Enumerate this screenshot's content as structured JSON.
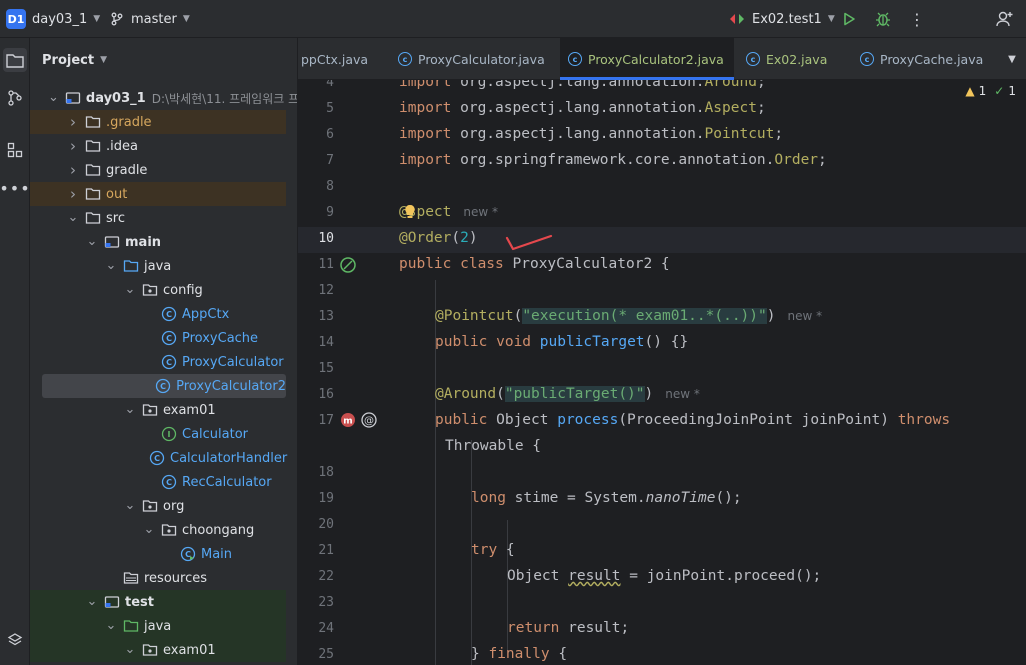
{
  "titlebar": {
    "project_badge": "D1",
    "project_name": "day03_1",
    "branch": "master",
    "run_config": "Ex02.test1"
  },
  "sidebar_left": {
    "icons": [
      "folder-icon",
      "git-icon",
      "structure-icon",
      "more-icon"
    ]
  },
  "project_panel": {
    "title": "Project",
    "tree": [
      {
        "label": "day03_1",
        "hint": "D:\\박세현\\11. 프레임워크 프",
        "type": "module",
        "expanded": true,
        "bold": true
      },
      {
        "label": ".gradle",
        "type": "folder",
        "expanded": false,
        "excluded": true
      },
      {
        "label": ".idea",
        "type": "folder",
        "expanded": false
      },
      {
        "label": "gradle",
        "type": "folder",
        "expanded": false
      },
      {
        "label": "out",
        "type": "folder",
        "expanded": false,
        "excluded": true
      },
      {
        "label": "src",
        "type": "folder",
        "expanded": true
      },
      {
        "label": "main",
        "type": "module",
        "expanded": true,
        "bold": true
      },
      {
        "label": "java",
        "type": "source-folder",
        "expanded": true
      },
      {
        "label": "config",
        "type": "package",
        "expanded": true
      },
      {
        "label": "AppCtx",
        "type": "class"
      },
      {
        "label": "ProxyCache",
        "type": "class"
      },
      {
        "label": "ProxyCalculator",
        "type": "class"
      },
      {
        "label": "ProxyCalculator2",
        "type": "class",
        "selected": true
      },
      {
        "label": "exam01",
        "type": "package",
        "expanded": true
      },
      {
        "label": "Calculator",
        "type": "interface"
      },
      {
        "label": "CalculatorHandler",
        "type": "class"
      },
      {
        "label": "RecCalculator",
        "type": "class"
      },
      {
        "label": "org",
        "type": "package",
        "expanded": true
      },
      {
        "label": "choongang",
        "type": "package",
        "expanded": true
      },
      {
        "label": "Main",
        "type": "main-class"
      },
      {
        "label": "resources",
        "type": "resources-folder"
      },
      {
        "label": "test",
        "type": "module",
        "expanded": true,
        "bold": true,
        "test": true
      },
      {
        "label": "java",
        "type": "test-source-folder",
        "expanded": true,
        "test": true
      },
      {
        "label": "exam01",
        "type": "package",
        "expanded": true,
        "test": true
      }
    ]
  },
  "tabs": [
    {
      "label": "ppCtx.java",
      "active": false
    },
    {
      "label": "ProxyCalculator.java",
      "active": false
    },
    {
      "label": "ProxyCalculator2.java",
      "active": true,
      "modified": true
    },
    {
      "label": "Ex02.java",
      "active": false,
      "modified": true
    },
    {
      "label": "ProxyCache.java",
      "active": false
    }
  ],
  "editor": {
    "inspection": {
      "warnings": "1",
      "ok": "1"
    },
    "line_numbers": [
      "4",
      "5",
      "6",
      "7",
      "8",
      "9",
      "10",
      "11",
      "12",
      "13",
      "14",
      "15",
      "16",
      "17",
      "",
      "18",
      "19",
      "20",
      "21",
      "22",
      "23",
      "24",
      "25"
    ],
    "hints": {
      "aspect": "new *",
      "pointcut": "new *",
      "around": "new *"
    },
    "code": {
      "l4_kw": "import ",
      "l4_rest": "org.aspectj.lang.annotation.",
      "l4_cls": "Around",
      "l4_end": ";",
      "l5_kw": "import ",
      "l5_rest": "org.aspectj.lang.annotation.",
      "l5_cls": "Aspect",
      "l5_end": ";",
      "l6_kw": "import ",
      "l6_rest": "org.aspectj.lang.annotation.",
      "l6_cls": "Pointcut",
      "l6_end": ";",
      "l7_kw": "import ",
      "l7_rest": "org.springframework.core.annotation.",
      "l7_cls": "Order",
      "l7_end": ";",
      "l9_a": "@",
      "l9_b": "spect",
      "l10_ann": "@Order",
      "l10_open": "(",
      "l10_num": "2",
      "l10_close": ")",
      "l11_kw": "public class ",
      "l11_rest": "ProxyCalculator2 {",
      "l13_ann": "@Pointcut",
      "l13_open": "(",
      "l13_str": "\"execution(* exam01..*(..))\"",
      "l13_close": ")",
      "l14_kw": "public void ",
      "l14_fn": "publicTarget",
      "l14_rest": "() {}",
      "l16_ann": "@Around",
      "l16_open": "(",
      "l16_str": "\"publicTarget()\"",
      "l16_close": ")",
      "l17_kw": "public ",
      "l17_type": "Object ",
      "l17_fn": "process",
      "l17_rest": "(ProceedingJoinPoint joinPoint) ",
      "l17_kw2": "throws",
      "l17b": "Throwable {",
      "l19_kw": "long ",
      "l19_rest": "stime = System.",
      "l19_fn": "nanoTime",
      "l19_end": "();",
      "l21_kw": "try ",
      "l21_rest": "{",
      "l22_a": "Object ",
      "l22_b": "result",
      "l22_c": " = joinPoint.proceed();",
      "l24_kw": "return ",
      "l24_rest": "result;",
      "l25_a": "} ",
      "l25_kw": "finally ",
      "l25_b": "{"
    }
  },
  "colors": {
    "accent": "#3574f0",
    "run_green": "#5fb865",
    "annotation_mark": "#e5484d"
  }
}
